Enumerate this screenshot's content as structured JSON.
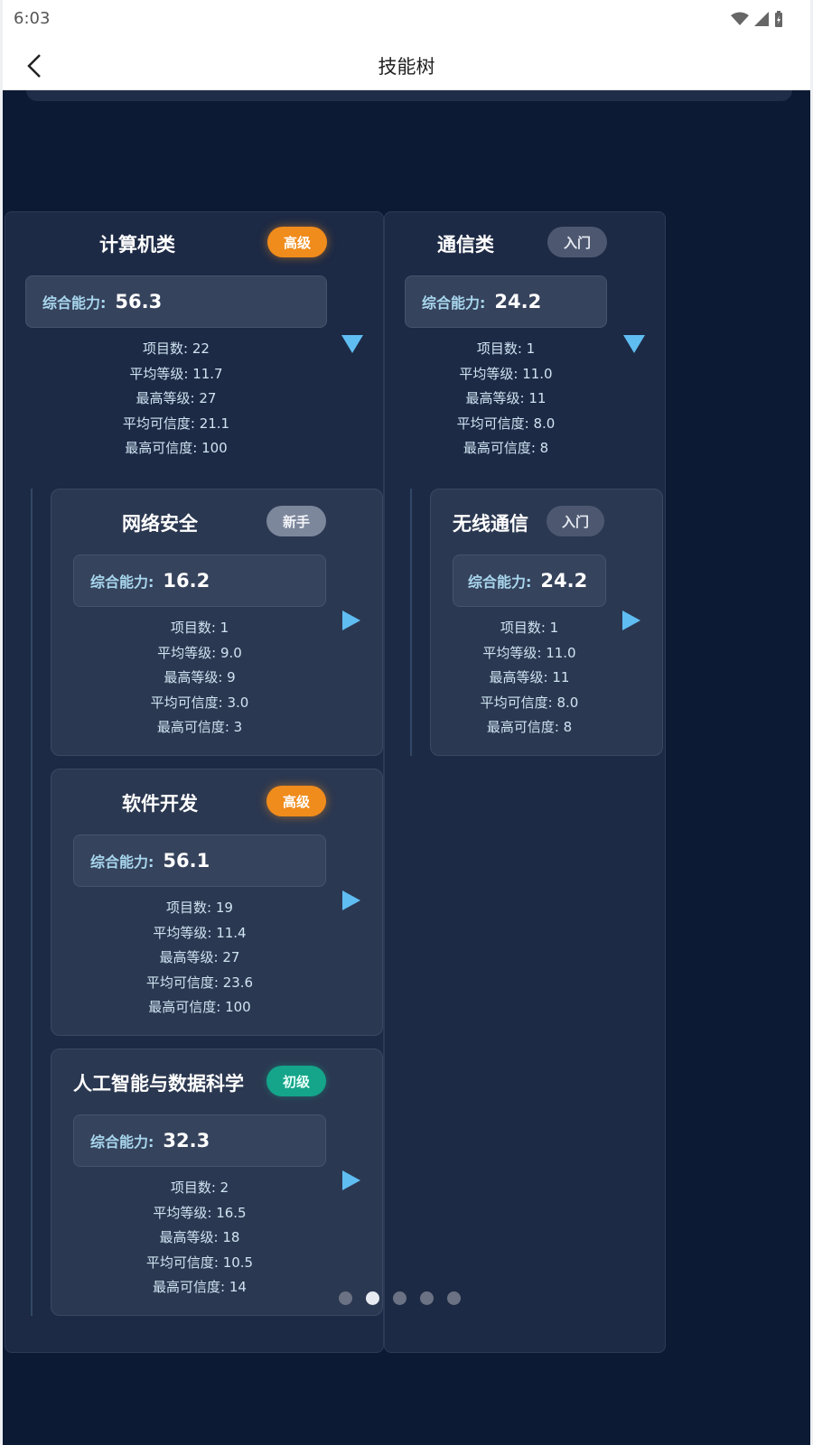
{
  "status": {
    "time": "6:03"
  },
  "appbar": {
    "title": "技能树"
  },
  "labels": {
    "ability": "综合能力:",
    "projects": "项目数",
    "avg_level": "平均等级",
    "max_level": "最高等级",
    "avg_cred": "平均可信度",
    "max_cred": "最高可信度"
  },
  "categories": [
    {
      "name": "计算机类",
      "badge": "高级",
      "badge_color": "#f08c1c",
      "ability": "56.3",
      "stats": [
        "项目数: 22",
        "平均等级: 11.7",
        "最高等级: 27",
        "平均可信度: 21.1",
        "最高可信度: 100"
      ],
      "children": [
        {
          "name": "网络安全",
          "badge": "新手",
          "ability": "16.2",
          "stats": [
            "项目数: 1",
            "平均等级: 9.0",
            "最高等级: 9",
            "平均可信度: 3.0",
            "最高可信度: 3"
          ]
        },
        {
          "name": "软件开发",
          "badge": "高级",
          "ability": "56.1",
          "stats": [
            "项目数: 19",
            "平均等级: 11.4",
            "最高等级: 27",
            "平均可信度: 23.6",
            "最高可信度: 100"
          ]
        },
        {
          "name": "人工智能与数据科学",
          "badge": "初级",
          "ability": "32.3",
          "stats": [
            "项目数: 2",
            "平均等级: 16.5",
            "最高等级: 18",
            "平均可信度: 10.5",
            "最高可信度: 14"
          ]
        }
      ]
    },
    {
      "name": "通信类",
      "badge": "入门",
      "badge_color": "#4d5870",
      "ability": "24.2",
      "stats": [
        "项目数: 1",
        "平均等级: 11.0",
        "最高等级: 11",
        "平均可信度: 8.0",
        "最高可信度: 8"
      ],
      "children": [
        {
          "name": "无线通信",
          "badge": "入门",
          "ability": "24.2",
          "stats": [
            "项目数: 1",
            "平均等级: 11.0",
            "最高等级: 11",
            "平均可信度: 8.0",
            "最高可信度: 8"
          ]
        }
      ]
    }
  ],
  "pager": {
    "count": 5,
    "active_index": 1
  },
  "colors": {
    "background": "#0c1a34",
    "accent_arrow": "#5fbdf2",
    "ability_label": "#a8d7ee"
  }
}
